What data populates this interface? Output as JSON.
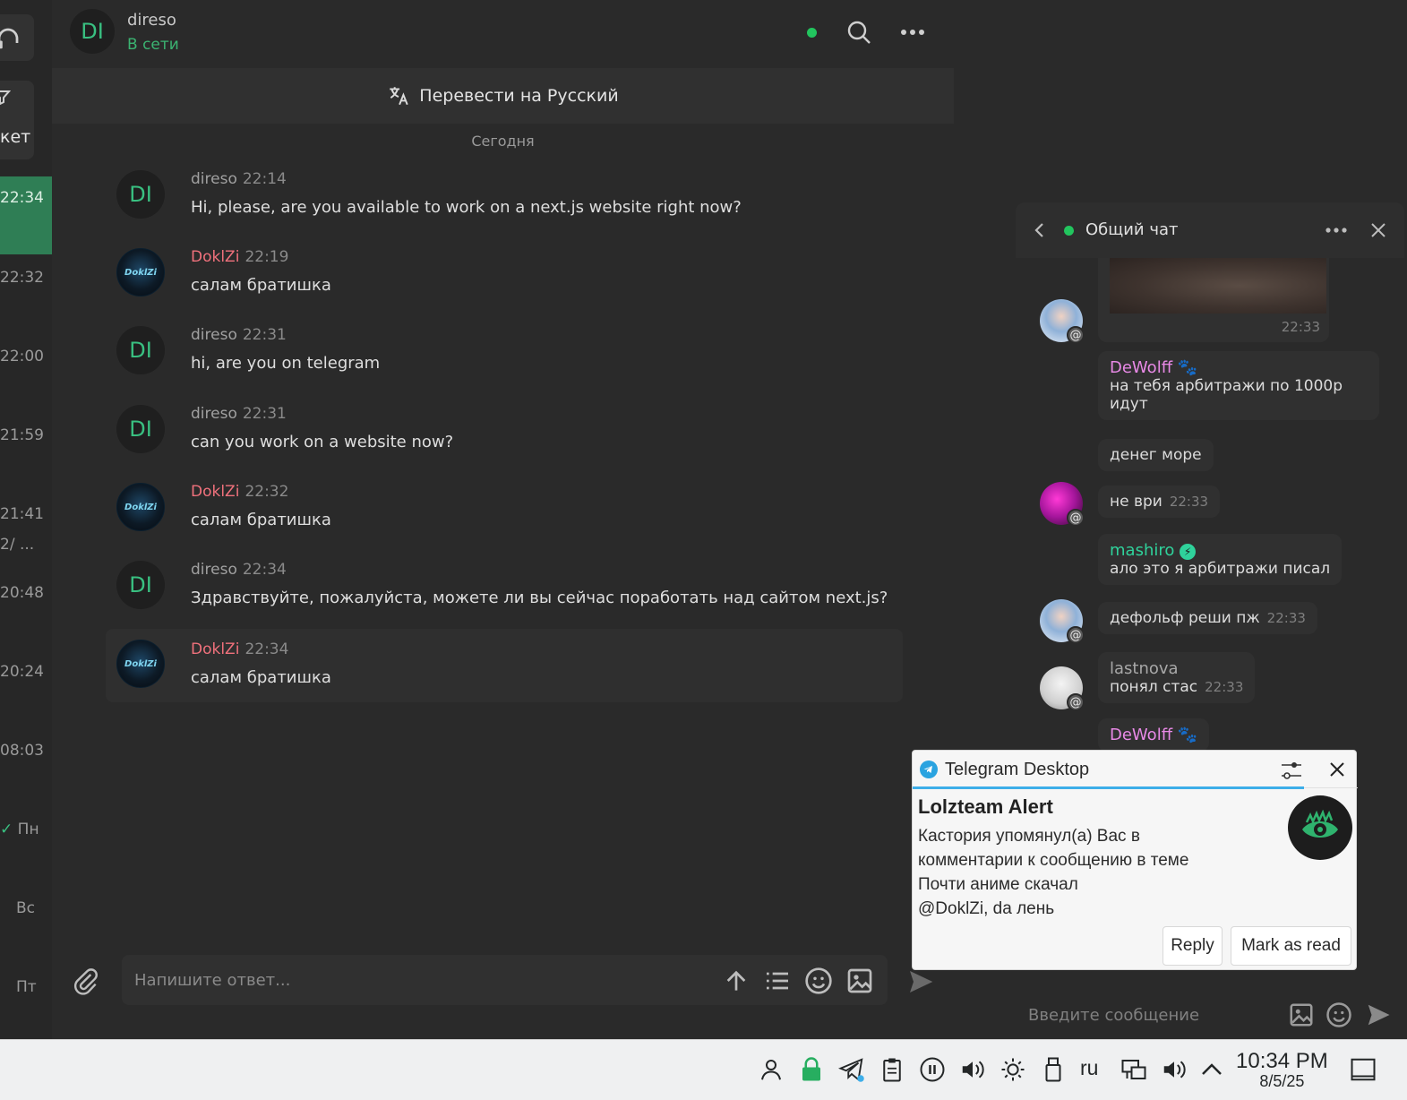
{
  "left_list": {
    "partial_label": "кет",
    "times": [
      "22:34",
      "22:32",
      "22:00",
      "21:59",
      "21:41",
      "2/ ...",
      "20:48",
      "20:24",
      "08:03",
      "Пн",
      "Вс",
      "Пт"
    ]
  },
  "header": {
    "avatar_initials": "DI",
    "name": "direso",
    "status": "В сети"
  },
  "translate_bar": {
    "label": "Перевести на Русский"
  },
  "day_separator": "Сегодня",
  "messages": [
    {
      "author": "direso",
      "time": "22:14",
      "text": "Hi, please, are you available to work on a next.js website right now?",
      "avatar": "DI"
    },
    {
      "author": "DoklZi",
      "time": "22:19",
      "text": "салам братишка",
      "avatar": "DoklZi"
    },
    {
      "author": "direso",
      "time": "22:31",
      "text": "hi, are you on telegram",
      "avatar": "DI"
    },
    {
      "author": "direso",
      "time": "22:31",
      "text": "can you work on a website now?",
      "avatar": "DI"
    },
    {
      "author": "DoklZi",
      "time": "22:32",
      "text": "салам братишка",
      "avatar": "DoklZi"
    },
    {
      "author": "direso",
      "time": "22:34",
      "text": "Здравствуйте, пожалуйста, можете ли вы сейчас поработать над сайтом next.js?",
      "avatar": "DI"
    },
    {
      "author": "DoklZi",
      "time": "22:34",
      "text": "салам братишка",
      "avatar": "DoklZi"
    }
  ],
  "composer": {
    "placeholder": "Напишите ответ..."
  },
  "side_chat": {
    "title": "Общий чат",
    "image_time": "22:33",
    "messages": [
      {
        "author": "DeWolff",
        "text": "на тебя арбитражи по 1000р",
        "text2": "идут"
      },
      {
        "text": "денег море"
      },
      {
        "text": "не ври",
        "time": "22:33"
      },
      {
        "author": "mashiro",
        "text": "ало это я арбитражи писал"
      },
      {
        "text": "дефольф реши пж",
        "time": "22:33"
      },
      {
        "author": "lastnova",
        "text": "понял стас",
        "time": "22:33"
      },
      {
        "author": "DeWolff"
      }
    ],
    "composer_placeholder": "Введите сообщение",
    "at_badge": "@"
  },
  "notification": {
    "app": "Telegram Desktop",
    "title": "Lolzteam Alert",
    "body_lines": [
      "Кастория упомянул(а) Вас в",
      "комментарии к сообщению в теме",
      "Почти аниме скачал",
      "@DoklZi, da лень"
    ],
    "reply_label": "Reply",
    "mark_read_label": "Mark as read"
  },
  "taskbar": {
    "language": "ru",
    "time": "10:34 PM",
    "date": "8/5/25"
  },
  "colors": {
    "accent_green": "#2f7e55",
    "online": "#22c55e",
    "author_pink": "#f0717c",
    "name_magenta": "#e889e6",
    "name_teal": "#2fd29b",
    "notification_line": "#3daee9"
  }
}
